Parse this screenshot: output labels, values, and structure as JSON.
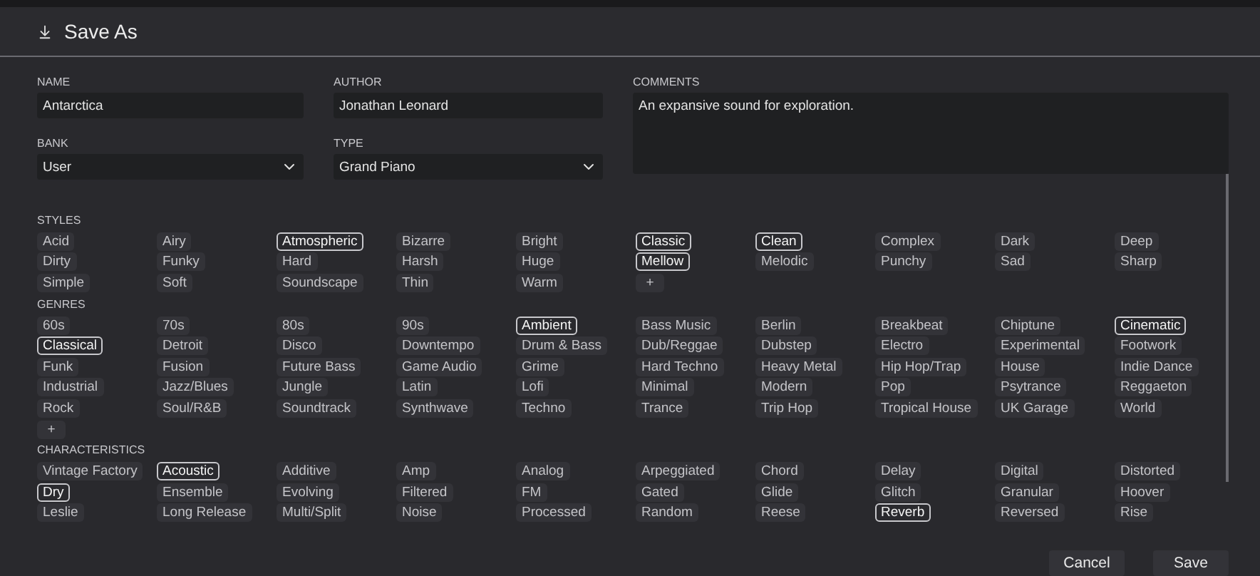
{
  "window": {
    "title": "Save As"
  },
  "fields": [
    {
      "label": "NAME",
      "value": "Antarctica",
      "kind": "text"
    },
    {
      "label": "AUTHOR",
      "value": "Jonathan Leonard",
      "kind": "text"
    },
    {
      "label": "BANK",
      "value": "User",
      "kind": "dropdown"
    },
    {
      "label": "TYPE",
      "value": "Grand Piano",
      "kind": "dropdown"
    }
  ],
  "comments": {
    "label": "COMMENTS",
    "value": "An expansive sound for exploration."
  },
  "sections": [
    {
      "title": "STYLES",
      "add_label": "+",
      "tags": [
        {
          "label": "Acid",
          "selected": false
        },
        {
          "label": "Airy",
          "selected": false
        },
        {
          "label": "Atmospheric",
          "selected": true
        },
        {
          "label": "Bizarre",
          "selected": false
        },
        {
          "label": "Bright",
          "selected": false
        },
        {
          "label": "Classic",
          "selected": true
        },
        {
          "label": "Clean",
          "selected": true
        },
        {
          "label": "Complex",
          "selected": false
        },
        {
          "label": "Dark",
          "selected": false
        },
        {
          "label": "Deep",
          "selected": false
        },
        {
          "label": "Dirty",
          "selected": false
        },
        {
          "label": "Funky",
          "selected": false
        },
        {
          "label": "Hard",
          "selected": false
        },
        {
          "label": "Harsh",
          "selected": false
        },
        {
          "label": "Huge",
          "selected": false
        },
        {
          "label": "Mellow",
          "selected": true
        },
        {
          "label": "Melodic",
          "selected": false
        },
        {
          "label": "Punchy",
          "selected": false
        },
        {
          "label": "Sad",
          "selected": false
        },
        {
          "label": "Sharp",
          "selected": false
        },
        {
          "label": "Simple",
          "selected": false
        },
        {
          "label": "Soft",
          "selected": false
        },
        {
          "label": "Soundscape",
          "selected": false
        },
        {
          "label": "Thin",
          "selected": false
        },
        {
          "label": "Warm",
          "selected": false
        }
      ]
    },
    {
      "title": "GENRES",
      "add_label": "+",
      "tags": [
        {
          "label": "60s",
          "selected": false
        },
        {
          "label": "70s",
          "selected": false
        },
        {
          "label": "80s",
          "selected": false
        },
        {
          "label": "90s",
          "selected": false
        },
        {
          "label": "Ambient",
          "selected": true
        },
        {
          "label": "Bass Music",
          "selected": false
        },
        {
          "label": "Berlin",
          "selected": false
        },
        {
          "label": "Breakbeat",
          "selected": false
        },
        {
          "label": "Chiptune",
          "selected": false
        },
        {
          "label": "Cinematic",
          "selected": true
        },
        {
          "label": "Classical",
          "selected": true
        },
        {
          "label": "Detroit",
          "selected": false
        },
        {
          "label": "Disco",
          "selected": false
        },
        {
          "label": "Downtempo",
          "selected": false
        },
        {
          "label": "Drum & Bass",
          "selected": false
        },
        {
          "label": "Dub/Reggae",
          "selected": false
        },
        {
          "label": "Dubstep",
          "selected": false
        },
        {
          "label": "Electro",
          "selected": false
        },
        {
          "label": "Experimental",
          "selected": false
        },
        {
          "label": "Footwork",
          "selected": false
        },
        {
          "label": "Funk",
          "selected": false
        },
        {
          "label": "Fusion",
          "selected": false
        },
        {
          "label": "Future Bass",
          "selected": false
        },
        {
          "label": "Game Audio",
          "selected": false
        },
        {
          "label": "Grime",
          "selected": false
        },
        {
          "label": "Hard Techno",
          "selected": false
        },
        {
          "label": "Heavy Metal",
          "selected": false
        },
        {
          "label": "Hip Hop/Trap",
          "selected": false
        },
        {
          "label": "House",
          "selected": false
        },
        {
          "label": "Indie Dance",
          "selected": false
        },
        {
          "label": "Industrial",
          "selected": false
        },
        {
          "label": "Jazz/Blues",
          "selected": false
        },
        {
          "label": "Jungle",
          "selected": false
        },
        {
          "label": "Latin",
          "selected": false
        },
        {
          "label": "Lofi",
          "selected": false
        },
        {
          "label": "Minimal",
          "selected": false
        },
        {
          "label": "Modern",
          "selected": false
        },
        {
          "label": "Pop",
          "selected": false
        },
        {
          "label": "Psytrance",
          "selected": false
        },
        {
          "label": "Reggaeton",
          "selected": false
        },
        {
          "label": "Rock",
          "selected": false
        },
        {
          "label": "Soul/R&B",
          "selected": false
        },
        {
          "label": "Soundtrack",
          "selected": false
        },
        {
          "label": "Synthwave",
          "selected": false
        },
        {
          "label": "Techno",
          "selected": false
        },
        {
          "label": "Trance",
          "selected": false
        },
        {
          "label": "Trip Hop",
          "selected": false
        },
        {
          "label": "Tropical House",
          "selected": false
        },
        {
          "label": "UK Garage",
          "selected": false
        },
        {
          "label": "World",
          "selected": false
        }
      ]
    },
    {
      "title": "CHARACTERISTICS",
      "tags": [
        {
          "label": "Vintage Factory",
          "selected": false
        },
        {
          "label": "Acoustic",
          "selected": true
        },
        {
          "label": "Additive",
          "selected": false
        },
        {
          "label": "Amp",
          "selected": false
        },
        {
          "label": "Analog",
          "selected": false
        },
        {
          "label": "Arpeggiated",
          "selected": false
        },
        {
          "label": "Chord",
          "selected": false
        },
        {
          "label": "Delay",
          "selected": false
        },
        {
          "label": "Digital",
          "selected": false
        },
        {
          "label": "Distorted",
          "selected": false
        },
        {
          "label": "Dry",
          "selected": true
        },
        {
          "label": "Ensemble",
          "selected": false
        },
        {
          "label": "Evolving",
          "selected": false
        },
        {
          "label": "Filtered",
          "selected": false
        },
        {
          "label": "FM",
          "selected": false
        },
        {
          "label": "Gated",
          "selected": false
        },
        {
          "label": "Glide",
          "selected": false
        },
        {
          "label": "Glitch",
          "selected": false
        },
        {
          "label": "Granular",
          "selected": false
        },
        {
          "label": "Hoover",
          "selected": false
        },
        {
          "label": "Leslie",
          "selected": false
        },
        {
          "label": "Long Release",
          "selected": false
        },
        {
          "label": "Multi/Split",
          "selected": false
        },
        {
          "label": "Noise",
          "selected": false
        },
        {
          "label": "Processed",
          "selected": false
        },
        {
          "label": "Random",
          "selected": false
        },
        {
          "label": "Reese",
          "selected": false
        },
        {
          "label": "Reverb",
          "selected": true
        },
        {
          "label": "Reversed",
          "selected": false
        },
        {
          "label": "Rise",
          "selected": false
        }
      ]
    }
  ],
  "buttons": [
    "Cancel",
    "Save"
  ]
}
